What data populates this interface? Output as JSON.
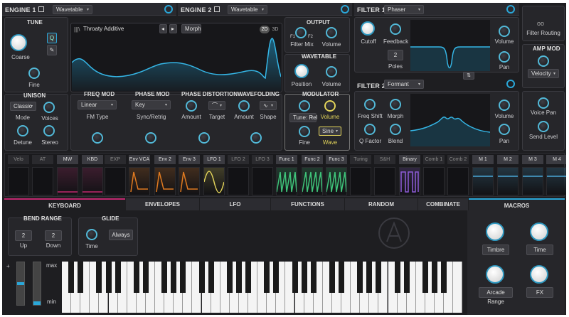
{
  "engine1": {
    "title": "ENGINE 1",
    "type": "Wavetable"
  },
  "engine2": {
    "title": "ENGINE 2",
    "type": "Wavetable"
  },
  "tune": {
    "title": "TUNE",
    "q_label": "Q",
    "coarse": "Coarse",
    "fine": "Fine"
  },
  "wavetable_view": {
    "name": "Throaty Additive",
    "morph": "Morph",
    "mode_2d": "2D",
    "mode_3d": "3D"
  },
  "output": {
    "title": "OUTPUT",
    "filter_mix": "Filter Mix",
    "volume": "Volume",
    "f1": "F1",
    "f2": "F2"
  },
  "wavetable": {
    "title": "WAVETABLE",
    "position": "Position",
    "volume": "Volume"
  },
  "unison": {
    "title": "UNISON",
    "mode_value": "Classic",
    "mode": "Mode",
    "voices": "Voices",
    "detune": "Detune",
    "stereo": "Stereo"
  },
  "freq_mod": {
    "title": "FREQ MOD",
    "value": "Linear",
    "label": "FM Type"
  },
  "phase_mod": {
    "title": "PHASE MOD",
    "value": "Key",
    "label": "Sync/Retrig"
  },
  "phase_distortion": {
    "title": "PHASE DISTORTION",
    "amount": "Amount",
    "target": "Target"
  },
  "wavefolding": {
    "title": "WAVEFOLDING",
    "amount": "Amount",
    "shape": "Shape"
  },
  "modulator": {
    "title": "MODULATOR",
    "tune_value": "Tune: Rel",
    "volume": "Volume",
    "fine": "Fine",
    "wave_value": "Sine",
    "wave": "Wave"
  },
  "filter1": {
    "title": "FILTER 1",
    "type": "Phaser",
    "cutoff": "Cutoff",
    "feedback": "Feedback",
    "poles_value": "2",
    "poles": "Poles",
    "volume": "Volume",
    "pan": "Pan"
  },
  "filter2": {
    "title": "FILTER 2",
    "type": "Formant",
    "freq_shift": "Freq Shift",
    "morph": "Morph",
    "q_factor": "Q Factor",
    "blend": "Blend",
    "volume": "Volume",
    "pan": "Pan"
  },
  "right": {
    "filter_routing": "Filter Routing",
    "amp_mod": "AMP MOD",
    "velocity": "Velocity",
    "voice_pan": "Voice Pan",
    "send_level": "Send Level"
  },
  "mod_sources": [
    "Velo",
    "AT",
    "MW",
    "KBD",
    "EXP",
    "Env VCA",
    "Env 2",
    "Env 3",
    "LFO 1",
    "LFO 2",
    "LFO 3",
    "Func 1",
    "Func 2",
    "Func 3",
    "Turing",
    "S&H",
    "Binary",
    "Comb 1",
    "Comb 2",
    "M 1",
    "M 2",
    "M 3",
    "M 4"
  ],
  "tabs": [
    "KEYBOARD",
    "ENVELOPES",
    "LFO",
    "FUNCTIONS",
    "RANDOM",
    "COMBINATE",
    "MACROS"
  ],
  "keyboard": {
    "bend_range": "BEND RANGE",
    "up_value": "2",
    "up": "Up",
    "down_value": "2",
    "down": "Down",
    "glide": "GLIDE",
    "glide_mode": "Always",
    "time": "Time",
    "plus": "+",
    "max": "max",
    "min": "min"
  },
  "macros": {
    "timbre": "Timbre",
    "time": "Time",
    "arcade_range": "Arcade Range",
    "fx": "FX"
  },
  "colors": {
    "accent": "#2aa7d8",
    "mod_pink": "#c0286f",
    "env_orange": "#e07a20",
    "lfo_yellow": "#e2d35a",
    "func_green": "#3fc47a",
    "binary_purple": "#8e5cd8",
    "macro_blue": "#4aa8d8"
  }
}
